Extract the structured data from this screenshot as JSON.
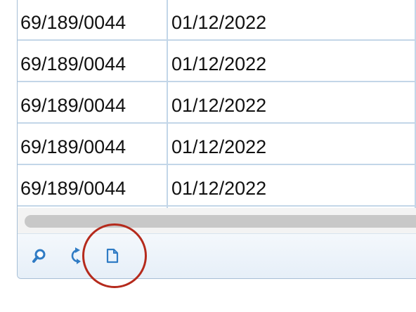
{
  "grid": {
    "rows": [
      {
        "id": "69/189/0044",
        "date": "01/12/2022"
      },
      {
        "id": "69/189/0044",
        "date": "01/12/2022"
      },
      {
        "id": "69/189/0044",
        "date": "01/12/2022"
      },
      {
        "id": "69/189/0044",
        "date": "01/12/2022"
      },
      {
        "id": "69/189/0044",
        "date": "01/12/2022"
      }
    ]
  },
  "toolbar": {
    "buttons": [
      {
        "icon": "search-icon"
      },
      {
        "icon": "refresh-icon"
      },
      {
        "icon": "document-icon"
      }
    ]
  },
  "colors": {
    "grid_line": "#c3d6e8",
    "toolbar_icon": "#2f7bc4",
    "highlight": "#b52a1c"
  }
}
